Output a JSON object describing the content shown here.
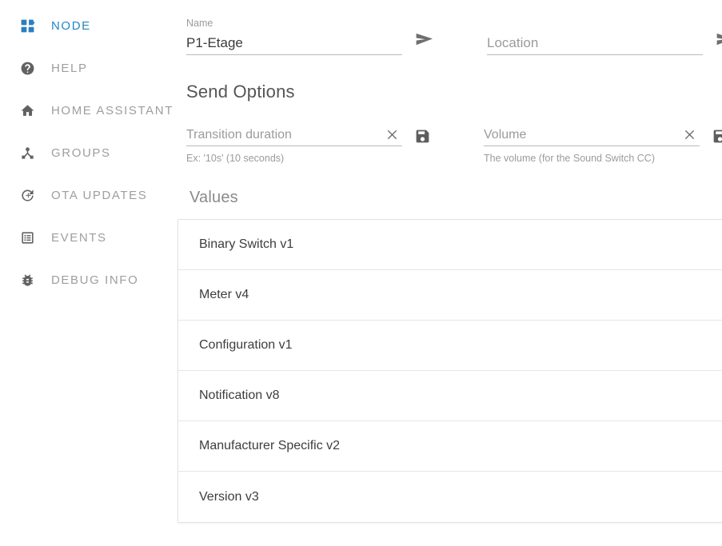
{
  "sidebar": {
    "items": [
      {
        "label": "NODE",
        "icon": "dashboard-icon",
        "active": true
      },
      {
        "label": "HELP",
        "icon": "help-circle-icon",
        "active": false
      },
      {
        "label": "HOME ASSISTANT",
        "icon": "home-icon",
        "active": false
      },
      {
        "label": "GROUPS",
        "icon": "device-hub-icon",
        "active": false
      },
      {
        "label": "OTA UPDATES",
        "icon": "update-icon",
        "active": false
      },
      {
        "label": "EVENTS",
        "icon": "list-alt-icon",
        "active": false
      },
      {
        "label": "DEBUG INFO",
        "icon": "bug-icon",
        "active": false
      }
    ],
    "active_color": "#2a7fc0",
    "inactive_color": "#9e9e9e"
  },
  "node_form": {
    "name_field": {
      "label": "Name",
      "value": "P1-Etage",
      "placeholder": "",
      "send_icon": "send-icon"
    },
    "location_field": {
      "label": "",
      "value": "",
      "placeholder": "Location",
      "send_icon": "send-icon"
    }
  },
  "send_options": {
    "title": "Send Options",
    "fields": [
      {
        "placeholder": "Transition duration",
        "value": "",
        "hint": "Ex: '10s' (10 seconds)",
        "clear_icon": "close-icon",
        "save_icon": "save-icon"
      },
      {
        "placeholder": "Volume",
        "value": "",
        "hint": "The volume (for the Sound Switch CC)",
        "clear_icon": "close-icon",
        "save_icon": "save-icon"
      }
    ]
  },
  "values": {
    "title": "Values",
    "rows": [
      {
        "label": "Binary Switch v1"
      },
      {
        "label": "Meter v4"
      },
      {
        "label": "Configuration v1"
      },
      {
        "label": "Notification v8"
      },
      {
        "label": "Manufacturer Specific v2"
      },
      {
        "label": "Version v3"
      }
    ]
  }
}
